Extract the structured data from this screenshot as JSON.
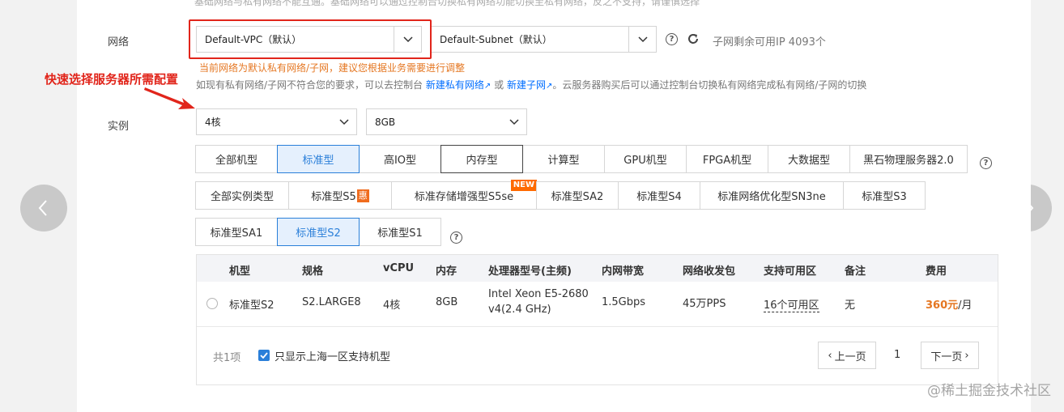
{
  "top_hint": "基础网络与私有网络不能互通。基础网络可以通过控制台切换私有网络功能切换至私有网络，反之不支持，请谨慎选择",
  "network": {
    "label": "网络",
    "vpc_value": "Default-VPC（默认）",
    "subnet_value": "Default-Subnet（默认）",
    "available_ip": "子网剩余可用IP 4093个",
    "warning": "当前网络为默认私有网络/子网，建议您根据业务需要进行调整",
    "hint_prefix": "如现有私有网络/子网不符合您的要求，可以去控制台",
    "hint_link1": "新建私有网络",
    "hint_or": "或",
    "hint_link2": "新建子网",
    "hint_suffix": "。云服务器购买后可以通过控制台切换私有网络完成私有网络/子网的切换"
  },
  "annotation": "快速选择服务器所需配置",
  "instance": {
    "label": "实例",
    "cpu_value": "4核",
    "mem_value": "8GB"
  },
  "families": [
    {
      "label": "全部机型",
      "selected": false
    },
    {
      "label": "标准型",
      "selected": true
    },
    {
      "label": "高IO型",
      "selected": false
    },
    {
      "label": "内存型",
      "selected": false
    },
    {
      "label": "计算型",
      "selected": false
    },
    {
      "label": "GPU机型",
      "selected": false
    },
    {
      "label": "FPGA机型",
      "selected": false
    },
    {
      "label": "大数据型",
      "selected": false
    },
    {
      "label": "黑石物理服务器2.0",
      "selected": false
    }
  ],
  "types_row1": [
    {
      "label": "全部实例类型"
    },
    {
      "label": "标准型S5",
      "badge": "惠"
    },
    {
      "label": "标准存储增强型S5se",
      "badge": "NEW"
    },
    {
      "label": "标准型SA2"
    },
    {
      "label": "标准型S4"
    },
    {
      "label": "标准网络优化型SN3ne"
    },
    {
      "label": "标准型S3"
    }
  ],
  "types_row2": [
    {
      "label": "标准型SA1",
      "selected": false
    },
    {
      "label": "标准型S2",
      "selected": true
    },
    {
      "label": "标准型S1",
      "selected": false
    }
  ],
  "table": {
    "headers": [
      "机型",
      "规格",
      "vCPU",
      "内存",
      "处理器型号(主频)",
      "内网带宽",
      "网络收发包",
      "支持可用区",
      "备注",
      "费用"
    ],
    "row": {
      "model": "标准型S2",
      "spec": "S2.LARGE8",
      "vcpu": "4核",
      "memory": "8GB",
      "cpu_line1": "Intel Xeon E5-2680",
      "cpu_line2": "v4(2.4 GHz)",
      "bandwidth": "1.5Gbps",
      "pps": "45万PPS",
      "zones": "16个可用区",
      "note": "无",
      "price": "360元",
      "price_unit": "/月"
    },
    "total": "共1项",
    "filter_label": "只显示上海一区支持机型",
    "prev": "上一页",
    "page": "1",
    "next": "下一页"
  },
  "watermark": "@稀土掘金技术社区",
  "colors": {
    "accent": "#2a7fd9",
    "warning": "#e57722",
    "annotation": "#e1251b",
    "price": "#e57722"
  }
}
